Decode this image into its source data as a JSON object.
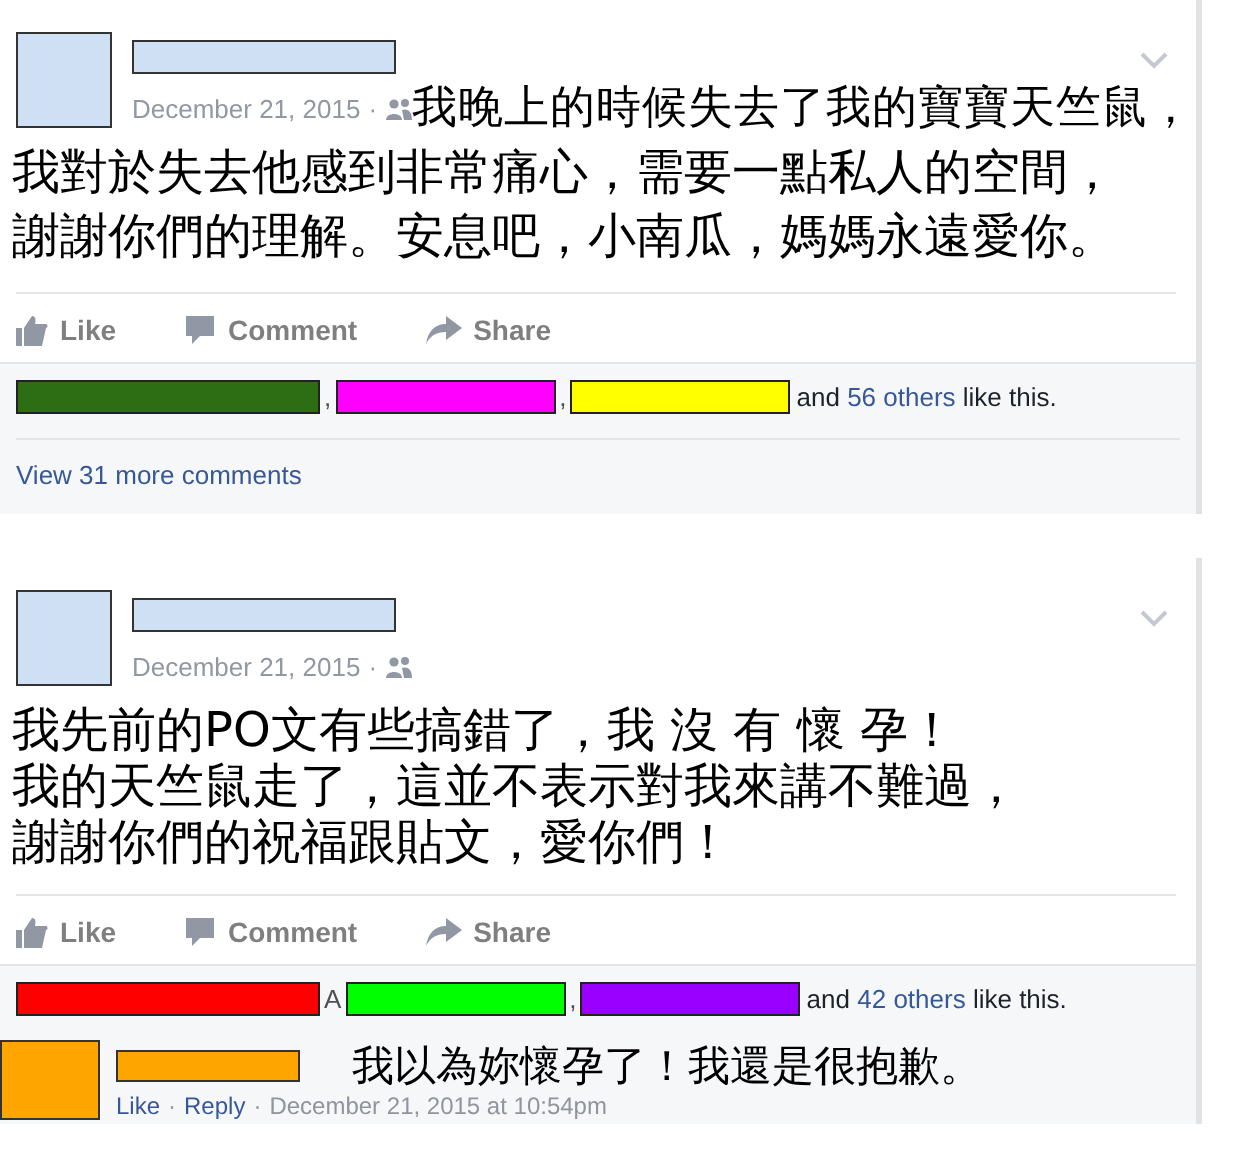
{
  "posts": [
    {
      "date": "December 21, 2015",
      "separator": "·",
      "caption_lines": [
        "我晚上的時候失去了我的寶寶天竺鼠，",
        "我對於失去他感到非常痛心，需要一點私人的空間，",
        "謝謝你們的理解。安息吧，小南瓜，媽媽永遠愛你。"
      ],
      "caption_indent_first": true,
      "actions": [
        "Like",
        "Comment",
        "Share"
      ],
      "likers": [
        {
          "color": "#2d6e14",
          "after": ","
        },
        {
          "color": "#ff00ff",
          "after": ","
        },
        {
          "color": "#ffff00"
        }
      ],
      "likes_and": "and",
      "likes_others": "56 others",
      "likes_suffix": "like this.",
      "more_comments": "View 31 more comments"
    },
    {
      "date": "December 21, 2015",
      "separator": "·",
      "caption_lines": [
        "我先前的PO文有些搞錯了，我 沒 有 懷 孕！",
        "我的天竺鼠走了，這並不表示對我來講不難過，",
        "謝謝你們的祝福跟貼文，愛你們！"
      ],
      "caption_indent_first": false,
      "actions": [
        "Like",
        "Comment",
        "Share"
      ],
      "likers": [
        {
          "color": "#ff0000",
          "after": "A"
        },
        {
          "color": "#00ff00",
          "after": ","
        },
        {
          "color": "#9900ff"
        }
      ],
      "likes_and": "and",
      "likes_others": "42 others",
      "likes_suffix": "like this.",
      "comment": {
        "text": "我以為妳懷孕了！我還是很抱歉。",
        "meta_links": [
          "Like",
          "Reply"
        ],
        "separator": "·",
        "time": "December 21, 2015 at 10:54pm"
      }
    }
  ]
}
